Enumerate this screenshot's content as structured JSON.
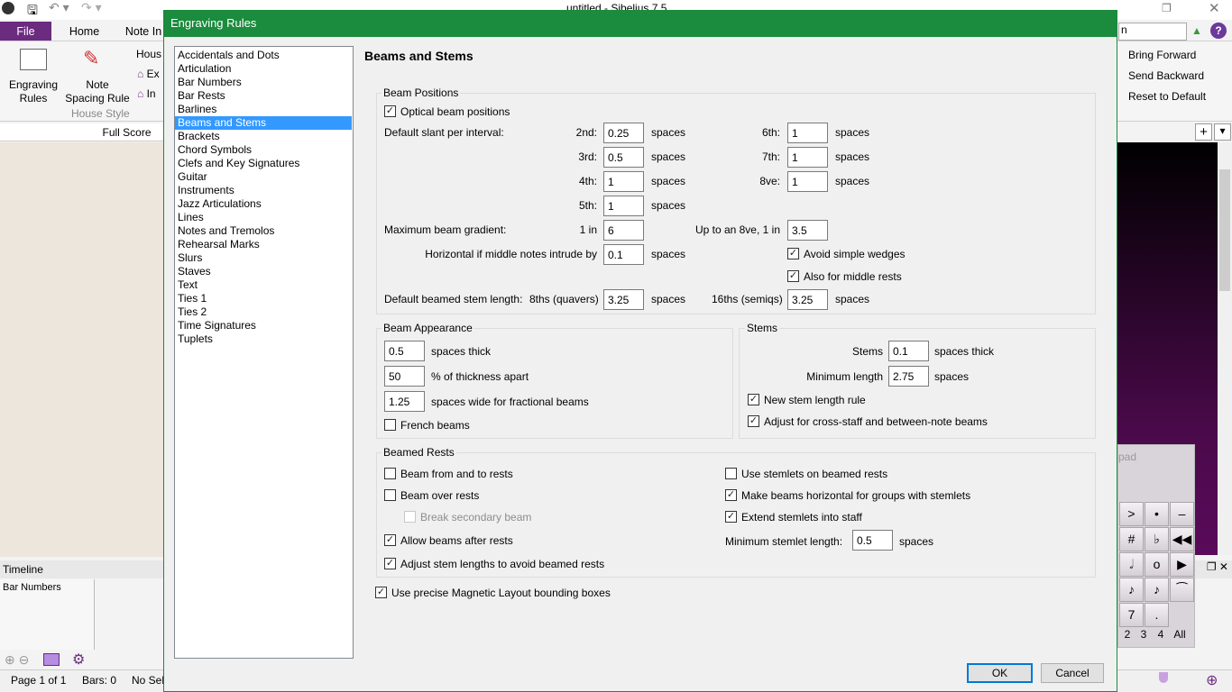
{
  "app": {
    "title": "untitled - Sibelius 7.5",
    "tabs": [
      "File",
      "Home",
      "Note In"
    ],
    "ribbon": {
      "engraving_rules": [
        "Engraving",
        "Rules"
      ],
      "note_spacing": [
        "Note",
        "Spacing Rule"
      ],
      "house_prefix": "Hous",
      "export": "Ex",
      "import": "In",
      "group_label": "House Style",
      "right_items": [
        "Bring Forward",
        "Send Backward",
        "Reset to Default"
      ],
      "search_partial": "n"
    },
    "score_tab": "Full Score",
    "timeline_title": "Timeline",
    "timeline_row": "Bar Numbers",
    "status": {
      "page": "Page 1 of 1",
      "bars": "Bars: 0",
      "selection": "No Sel"
    },
    "keypad": {
      "title": "pad",
      "tabs": [
        "2",
        "3",
        "4",
        "All"
      ],
      "keys": [
        ">",
        "•",
        "–",
        "#",
        "♭",
        "◀◀",
        "𝅗𝅥",
        "o",
        "▶",
        "♪",
        "♪",
        "⁀",
        "7",
        "."
      ]
    }
  },
  "accent": "#1b8b3d",
  "dialog": {
    "title": "Engraving Rules",
    "heading": "Beams and Stems",
    "categories": [
      "Accidentals and Dots",
      "Articulation",
      "Bar Numbers",
      "Bar Rests",
      "Barlines",
      "Beams and Stems",
      "Brackets",
      "Chord Symbols",
      "Clefs and Key Signatures",
      "Guitar",
      "Instruments",
      "Jazz Articulations",
      "Lines",
      "Notes and Tremolos",
      "Rehearsal Marks",
      "Slurs",
      "Staves",
      "Text",
      "Ties 1",
      "Ties 2",
      "Time Signatures",
      "Tuplets"
    ],
    "selected_category": "Beams and Stems",
    "beam_positions": {
      "title": "Beam Positions",
      "optical": {
        "label": "Optical beam positions",
        "checked": true
      },
      "slant_label": "Default slant per interval:",
      "spaces": "spaces",
      "slant": [
        {
          "label": "2nd:",
          "value": "0.25"
        },
        {
          "label": "3rd:",
          "value": "0.5"
        },
        {
          "label": "4th:",
          "value": "1"
        },
        {
          "label": "5th:",
          "value": "1"
        },
        {
          "label": "6th:",
          "value": "1"
        },
        {
          "label": "7th:",
          "value": "1"
        },
        {
          "label": "8ve:",
          "value": "1"
        }
      ],
      "max_gradient_label": "Maximum beam gradient:",
      "one_in": "1 in",
      "max_gradient": "6",
      "octave_label": "Up to an 8ve, 1 in",
      "octave_value": "3.5",
      "horizontal_label": "Horizontal if middle notes intrude by",
      "horizontal_value": "0.1",
      "avoid_wedges": {
        "label": "Avoid simple wedges",
        "checked": true
      },
      "middle_rests": {
        "label": "Also for middle rests",
        "checked": true
      },
      "stem_len_label": "Default beamed stem length:",
      "eighths_label": "8ths (quavers)",
      "eighths_value": "3.25",
      "sixteenths_label": "16ths (semiqs)",
      "sixteenths_value": "3.25"
    },
    "beam_appearance": {
      "title": "Beam Appearance",
      "thick_value": "0.5",
      "thick_label": "spaces thick",
      "apart_value": "50",
      "apart_label": "% of thickness apart",
      "frac_value": "1.25",
      "frac_label": "spaces wide for fractional beams",
      "french": {
        "label": "French beams",
        "checked": false
      }
    },
    "stems": {
      "title": "Stems",
      "stems_label": "Stems",
      "stems_value": "0.1",
      "stems_unit": "spaces thick",
      "min_label": "Minimum length",
      "min_value": "2.75",
      "min_unit": "spaces",
      "new_rule": {
        "label": "New stem length rule",
        "checked": true
      },
      "cross_staff": {
        "label": "Adjust for cross-staff and between-note beams",
        "checked": true
      }
    },
    "beamed_rests": {
      "title": "Beamed Rests",
      "left": [
        {
          "label": "Beam from and to rests",
          "checked": false
        },
        {
          "label": "Beam over rests",
          "checked": false
        },
        {
          "label": "Break secondary beam",
          "checked": false,
          "disabled": true
        },
        {
          "label": "Allow beams after rests",
          "checked": true
        },
        {
          "label": "Adjust stem lengths to avoid beamed rests",
          "checked": true
        }
      ],
      "right": [
        {
          "label": "Use stemlets on beamed rests",
          "checked": false
        },
        {
          "label": "Make beams horizontal for groups with stemlets",
          "checked": true
        },
        {
          "label": "Extend stemlets into staff",
          "checked": true
        }
      ],
      "min_stemlet_label": "Minimum stemlet length:",
      "min_stemlet_value": "0.5",
      "min_stemlet_unit": "spaces"
    },
    "magnetic": {
      "label": "Use precise Magnetic Layout bounding boxes",
      "checked": true
    },
    "ok": "OK",
    "cancel": "Cancel"
  }
}
